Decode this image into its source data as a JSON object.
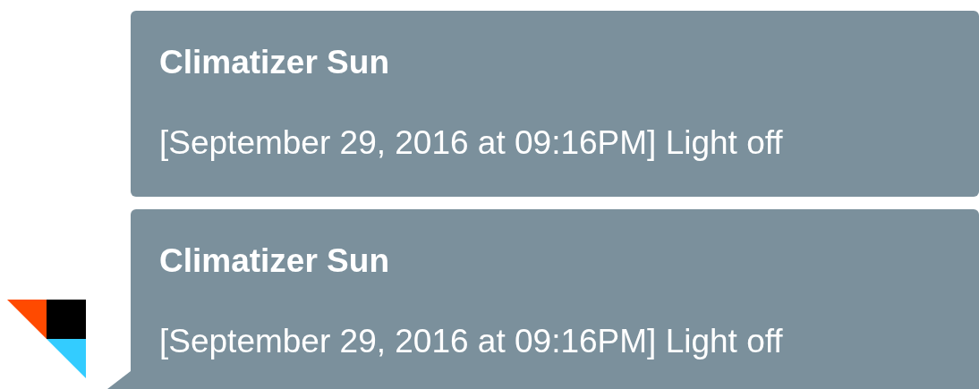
{
  "messages": [
    {
      "title": "Climatizer Sun",
      "text": "[September 29, 2016 at 09:16PM] Light off"
    },
    {
      "title": "Climatizer Sun",
      "text": "[September 29, 2016 at 09:16PM] Light off"
    }
  ]
}
